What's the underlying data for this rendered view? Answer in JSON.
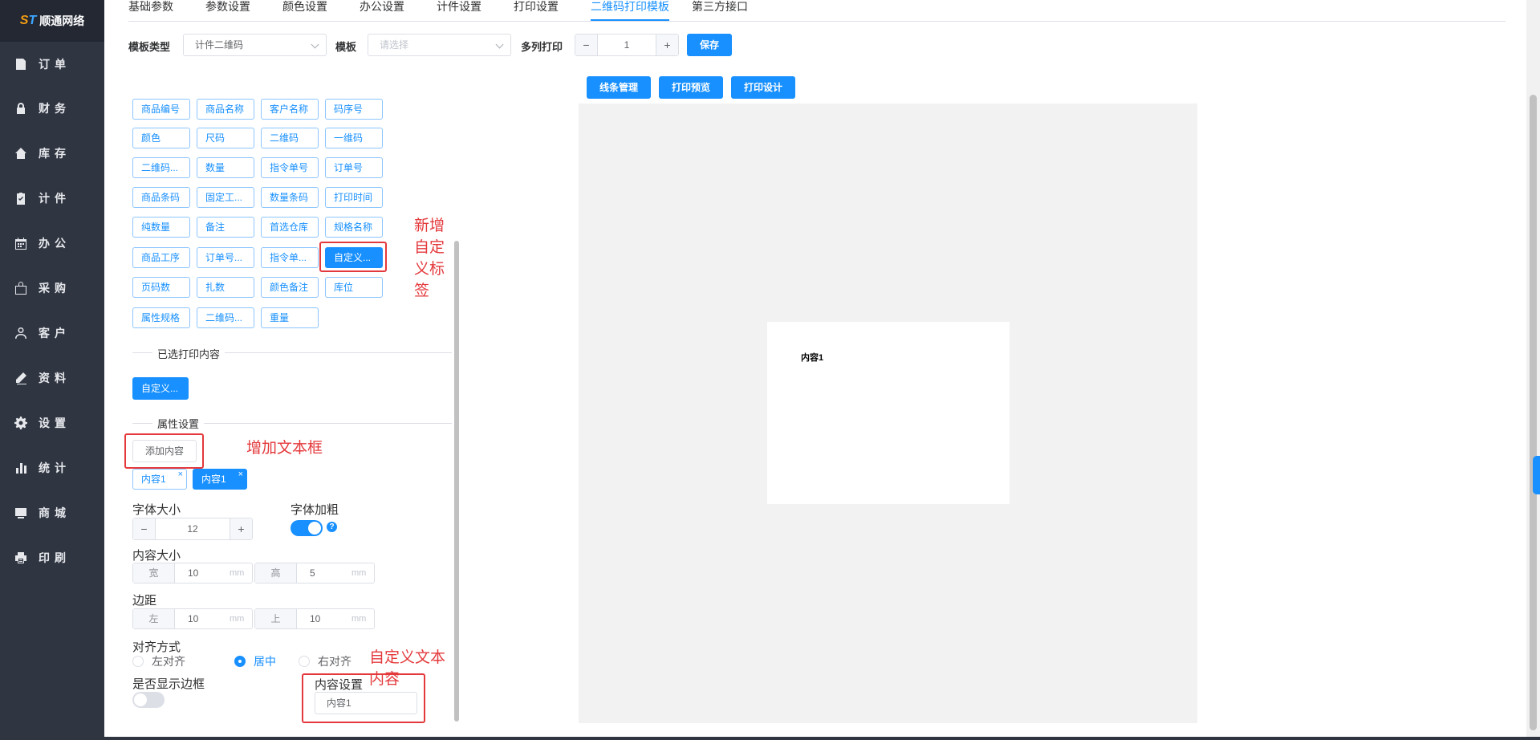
{
  "brand": {
    "name": "顺通网络",
    "mark": "ST"
  },
  "sidebar": {
    "items": [
      {
        "label": "订单",
        "icon": "order-icon"
      },
      {
        "label": "财务",
        "icon": "lock-icon"
      },
      {
        "label": "库存",
        "icon": "home-icon"
      },
      {
        "label": "计件",
        "icon": "clipboard-icon"
      },
      {
        "label": "办公",
        "icon": "calendar-icon"
      },
      {
        "label": "采购",
        "icon": "bag-icon"
      },
      {
        "label": "客户",
        "icon": "user-icon"
      },
      {
        "label": "资料",
        "icon": "pen-icon"
      },
      {
        "label": "设置",
        "icon": "gear-icon"
      },
      {
        "label": "统计",
        "icon": "bar-chart-icon"
      },
      {
        "label": "商城",
        "icon": "shop-icon"
      },
      {
        "label": "印刷",
        "icon": "printer-icon"
      }
    ]
  },
  "tabs": [
    "基础参数",
    "参数设置",
    "颜色设置",
    "办公设置",
    "计件设置",
    "打印设置",
    "二维码打印模板",
    "第三方接口"
  ],
  "active_tab": "二维码打印模板",
  "toolbar": {
    "template_type_label": "模板类型",
    "template_type_value": "计件二维码",
    "template_label": "模板",
    "template_placeholder": "请选择",
    "multi_print_label": "多列打印",
    "multi_print_value": "1",
    "minus": "−",
    "plus": "+",
    "save": "保存"
  },
  "actions": {
    "line_manage": "线条管理",
    "print_preview": "打印预览",
    "print_design": "打印设计"
  },
  "fields": [
    [
      "商品编号",
      "商品名称",
      "客户名称",
      "码序号"
    ],
    [
      "颜色",
      "尺码",
      "二维码",
      "一维码"
    ],
    [
      "二维码...",
      "数量",
      "指令单号",
      "订单号"
    ],
    [
      "商品条码",
      "固定工...",
      "数量条码",
      "打印时间"
    ],
    [
      "纯数量",
      "备注",
      "首选仓库",
      "规格名称"
    ],
    [
      "商品工序",
      "订单号...",
      "指令单...",
      "自定义..."
    ],
    [
      "页码数",
      "扎数",
      "颜色备注",
      "库位"
    ],
    [
      "属性规格",
      "二维码...",
      "重量"
    ]
  ],
  "selected_section": {
    "title": "已选打印内容",
    "items": [
      "自定义..."
    ]
  },
  "props_section": {
    "title": "属性设置"
  },
  "add_content": "添加内容",
  "content_tags": [
    "内容1",
    "内容1"
  ],
  "tag_close": "×",
  "font_size": {
    "label": "字体大小",
    "value": "12"
  },
  "font_bold": {
    "label": "字体加粗",
    "on": true,
    "help": "?"
  },
  "content_size": {
    "label": "内容大小",
    "w_label": "宽",
    "w": "10",
    "h_label": "高",
    "h": "5",
    "unit": "mm"
  },
  "margin": {
    "label": "边距",
    "l_label": "左",
    "l": "10",
    "t_label": "上",
    "t": "10",
    "unit": "mm"
  },
  "align": {
    "label": "对齐方式",
    "options": [
      "左对齐",
      "居中",
      "右对齐"
    ],
    "selected": "居中"
  },
  "show_border": {
    "label": "是否显示边框",
    "on": false
  },
  "content_setting": {
    "label": "内容设置",
    "value": "内容1"
  },
  "annotations": {
    "add_tag": "新增自定义标签",
    "add_textbox": "增加文本框",
    "custom_text": "自定义文本内容"
  },
  "canvas": {
    "text": "内容1"
  },
  "colors": {
    "sidebar": "#2f3541",
    "primary": "#1890ff",
    "annotation": "#e4393c"
  }
}
